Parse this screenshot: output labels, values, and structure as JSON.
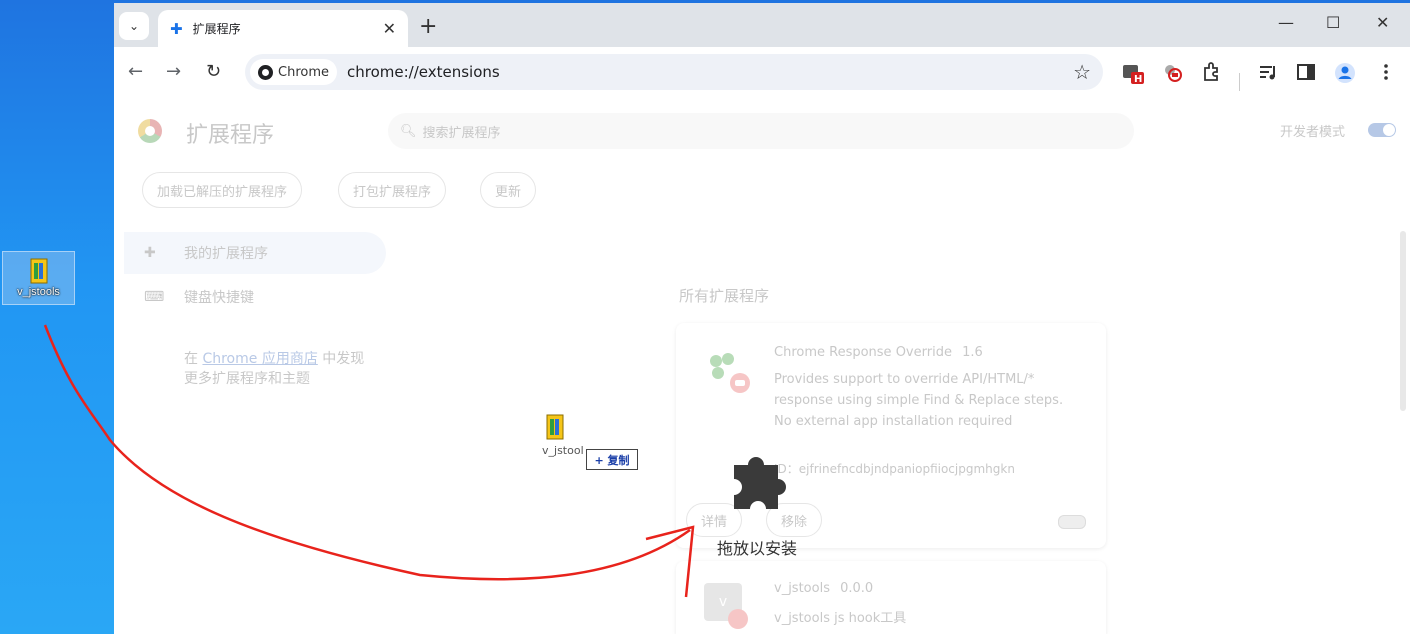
{
  "desktop": {
    "icon_label": "v_jstools"
  },
  "tab": {
    "title": "扩展程序",
    "close_glyph": "✕",
    "search_glyph": "⌄",
    "new_tab_glyph": "+"
  },
  "window_controls": {
    "minimize": "—",
    "maximize": "☐",
    "close": "✕"
  },
  "toolbar": {
    "back": "←",
    "forward": "→",
    "reload": "↻",
    "site_chip": "Chrome",
    "url": "chrome://extensions",
    "star": "☆"
  },
  "page": {
    "title": "扩展程序",
    "search_placeholder": "搜索扩展程序",
    "dev_mode_label": "开发者模式",
    "buttons": [
      "加载已解压的扩展程序",
      "打包扩展程序",
      "更新"
    ],
    "sidebar": {
      "my_extensions": "我的扩展程序",
      "shortcuts": "键盘快捷键",
      "store_prefix": "在 ",
      "store_link": "Chrome 应用商店",
      "store_suffix": " 中发现",
      "store_line2": "更多扩展程序和主题"
    },
    "section_title": "所有扩展程序",
    "extensions": [
      {
        "name": "Chrome Response Override",
        "version": "1.6",
        "description": "Provides support to override API/HTML/* response using simple Find & Replace steps. No external app installation required",
        "id_label": "ID：ejfrinefncdbjndpaniopfiiocjpgmhgkn",
        "details": "详情",
        "remove": "移除"
      },
      {
        "name": "v_jstools",
        "version": "0.0.0",
        "description": "v_jstools js hook工具",
        "avatar_letter": "v"
      }
    ]
  },
  "drag": {
    "ghost_label": "v_jstool",
    "copy_badge": "+ 复制",
    "drop_hint": "拖放以安装"
  },
  "colors": {
    "annotation_arrow": "#e8231c",
    "accent": "#1a73e8"
  },
  "icons": [
    "search-icon",
    "puzzle-icon",
    "star-icon",
    "profile-icon",
    "menu-icon"
  ]
}
